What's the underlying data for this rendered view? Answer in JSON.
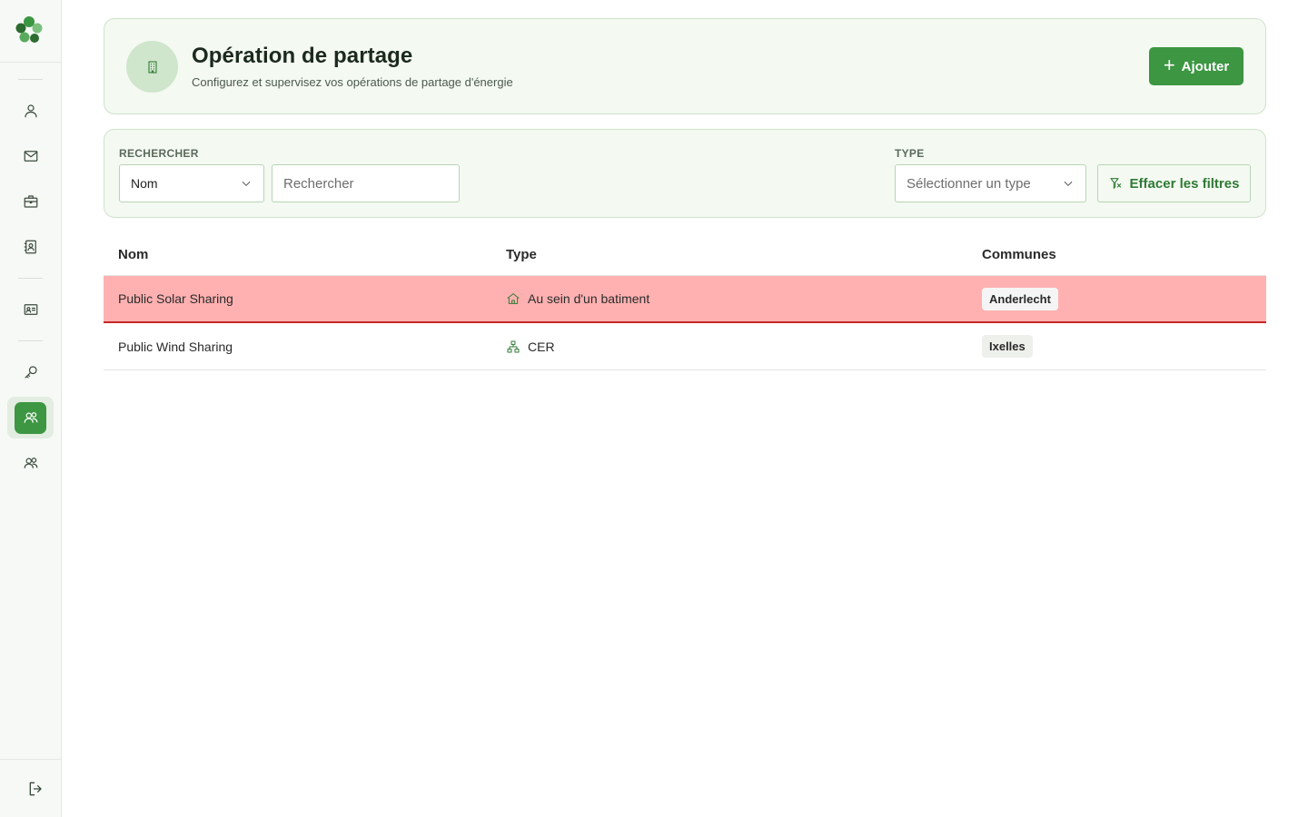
{
  "header": {
    "title": "Opération de partage",
    "subtitle": "Configurez et supervisez vos opérations de partage d'énergie",
    "add_label": "Ajouter"
  },
  "filters": {
    "search_label": "RECHERCHER",
    "search_field_value": "Nom",
    "search_placeholder": "Rechercher",
    "type_label": "TYPE",
    "type_placeholder": "Sélectionner un type",
    "clear_label": "Effacer les filtres"
  },
  "table": {
    "columns": [
      "Nom",
      "Type",
      "Communes"
    ],
    "rows": [
      {
        "name": "Public Solar Sharing",
        "type": "Au sein d'un batiment",
        "type_icon": "building-home-icon",
        "commune": "Anderlecht"
      },
      {
        "name": "Public Wind Sharing",
        "type": "CER",
        "type_icon": "network-hierarchy-icon",
        "commune": "Ixelles"
      }
    ]
  },
  "sidebar": {
    "items": [
      "user-icon",
      "mail-icon",
      "briefcase-icon",
      "contacts-book-icon",
      "id-card-icon",
      "key-icon",
      "group-icon",
      "group-icon"
    ],
    "active_index": 6
  },
  "colors": {
    "accent": "#3c9642",
    "card_bg": "#f4f9f2",
    "row_highlight": "#ffb1b1",
    "row_highlight_border": "#c62828"
  }
}
